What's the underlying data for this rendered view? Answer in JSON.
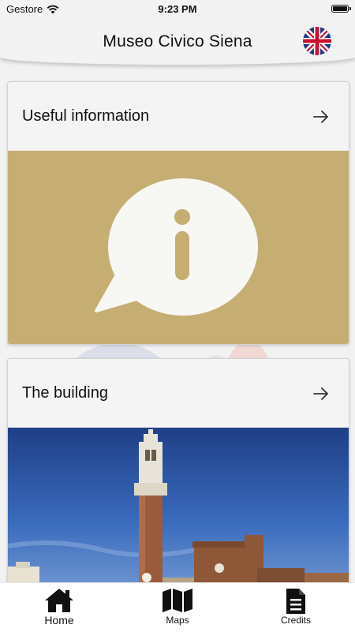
{
  "status_bar": {
    "carrier": "Gestore",
    "time": "9:23 PM",
    "icons": [
      "wifi-icon",
      "battery-icon"
    ]
  },
  "header": {
    "title": "Museo Civico Siena",
    "language_flag": "uk-flag-icon"
  },
  "cards": [
    {
      "title": "Useful information",
      "arrow_icon": "arrow-right-icon",
      "image_icon": "info-speech-bubble-icon",
      "panel_color": "#c6ae73"
    },
    {
      "title": "The building",
      "arrow_icon": "arrow-right-icon",
      "image": "torre-del-mangia-photo"
    }
  ],
  "bottom_nav": {
    "active": "Home",
    "items": [
      {
        "label": "Home",
        "icon": "home-icon"
      },
      {
        "label": "Maps",
        "icon": "map-icon"
      },
      {
        "label": "Credits",
        "icon": "document-icon"
      }
    ]
  },
  "colors": {
    "background": "#f2f2f2",
    "card_panel_gold": "#c6ae73",
    "sky_blue": "#2e5aa6",
    "text": "#111111"
  }
}
